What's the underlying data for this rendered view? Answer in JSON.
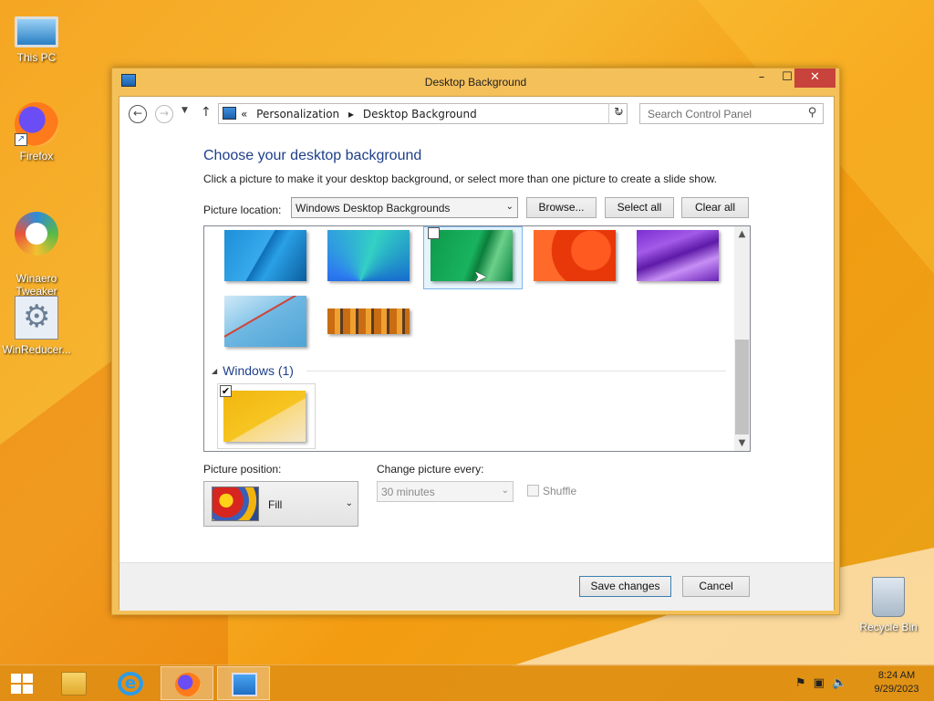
{
  "desktop": {
    "icons": [
      {
        "label": "This PC"
      },
      {
        "label": "Firefox"
      },
      {
        "label": "Winaero\nTweaker"
      },
      {
        "label": "WinReducer..."
      },
      {
        "label": "Recycle Bin"
      }
    ]
  },
  "window": {
    "title": "Desktop Background",
    "controls": {
      "minimize": "–",
      "maximize": "☐",
      "close": "✕"
    }
  },
  "address_bar": {
    "prefix": "«",
    "breadcrumb": [
      "Personalization",
      "Desktop Background"
    ],
    "separator": "▸"
  },
  "search": {
    "placeholder": "Search Control Panel"
  },
  "main": {
    "heading": "Choose your desktop background",
    "description": "Click a picture to make it your desktop background, or select more than one picture to create a slide show.",
    "picture_location_label": "Picture location:",
    "picture_location_value": "Windows Desktop Backgrounds",
    "browse_label": "Browse...",
    "select_all_label": "Select all",
    "clear_all_label": "Clear all"
  },
  "picture_list": {
    "group_label": "Windows (1)",
    "thumbnails": [
      {
        "checked": false
      },
      {
        "checked": false
      },
      {
        "checked": false,
        "hovered": true
      },
      {
        "checked": false
      },
      {
        "checked": false
      },
      {
        "checked": false
      },
      {
        "checked": false
      },
      {
        "checked": true,
        "group": "Windows"
      }
    ]
  },
  "options": {
    "picture_position_label": "Picture position:",
    "picture_position_value": "Fill",
    "change_every_label": "Change picture every:",
    "change_every_value": "30 minutes",
    "shuffle_label": "Shuffle"
  },
  "footer": {
    "save_label": "Save changes",
    "cancel_label": "Cancel"
  },
  "taskbar": {
    "time": "8:24 AM",
    "date": "9/29/2023"
  }
}
